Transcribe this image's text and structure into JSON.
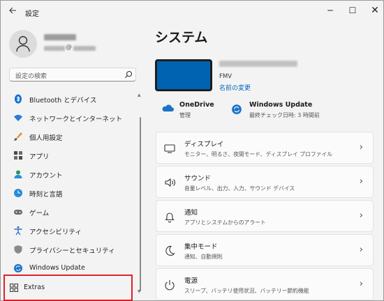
{
  "window": {
    "title": "設定",
    "back_icon": "arrow-left-icon",
    "controls": {
      "minimize": "─",
      "maximize": "☐",
      "close": "✕"
    }
  },
  "account": {
    "email_at": "@"
  },
  "search": {
    "placeholder": "設定の検索",
    "icon": "search-icon"
  },
  "sidebar": {
    "items": [
      {
        "label": "Bluetooth とデバイス",
        "icon": "bluetooth-icon"
      },
      {
        "label": "ネットワークとインターネット",
        "icon": "wifi-icon"
      },
      {
        "label": "個人用設定",
        "icon": "brush-icon"
      },
      {
        "label": "アプリ",
        "icon": "apps-icon"
      },
      {
        "label": "アカウント",
        "icon": "account-icon"
      },
      {
        "label": "時刻と言語",
        "icon": "clock-globe-icon"
      },
      {
        "label": "ゲーム",
        "icon": "gamepad-icon"
      },
      {
        "label": "アクセシビリティ",
        "icon": "accessibility-icon"
      },
      {
        "label": "プライバシーとセキュリティ",
        "icon": "shield-icon"
      },
      {
        "label": "Windows Update",
        "icon": "windows-update-icon"
      }
    ],
    "extras": {
      "label": "Extras",
      "icon": "grid-icon"
    }
  },
  "main": {
    "title": "システム",
    "device": {
      "model": "FMV",
      "rename_label": "名前の変更"
    },
    "onedrive": {
      "title": "OneDrive",
      "subtitle": "管理"
    },
    "update": {
      "title": "Windows Update",
      "subtitle": "最終チェック日時: 3 時間前"
    },
    "cards": [
      {
        "title": "ディスプレイ",
        "subtitle": "モニター、明るさ、夜間モード、ディスプレイ プロファイル",
        "icon": "monitor-icon"
      },
      {
        "title": "サウンド",
        "subtitle": "音量レベル、出力、入力、サウンド デバイス",
        "icon": "speaker-icon"
      },
      {
        "title": "通知",
        "subtitle": "アプリとシステムからのアラート",
        "icon": "bell-icon"
      },
      {
        "title": "集中モード",
        "subtitle": "通知、自動規則",
        "icon": "moon-icon"
      },
      {
        "title": "電源",
        "subtitle": "スリープ、バッテリ使用状況、バッテリー節約機能",
        "icon": "power-icon"
      }
    ]
  },
  "colors": {
    "accent": "#0067c0",
    "highlight_border": "#e0202a",
    "device_screen": "#0063b1"
  }
}
